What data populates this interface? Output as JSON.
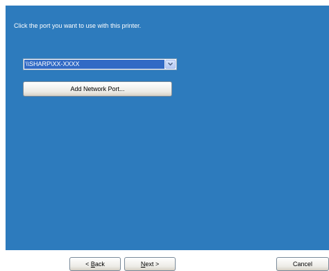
{
  "instruction": "Click the port you want to use with this printer.",
  "port_select": {
    "selected_value": "\\\\SHARP\\XX-XXXX",
    "icon": "chevron-down-icon"
  },
  "add_network_port_label": "Add Network Port...",
  "footer": {
    "back": {
      "prefix": "< ",
      "mnemonic": "B",
      "rest": "ack"
    },
    "next": {
      "mnemonic": "N",
      "rest": "ext",
      "suffix": " >"
    },
    "cancel": "Cancel"
  },
  "colors": {
    "panel_background": "#2d7bbd",
    "selection_highlight": "#316ac5"
  }
}
